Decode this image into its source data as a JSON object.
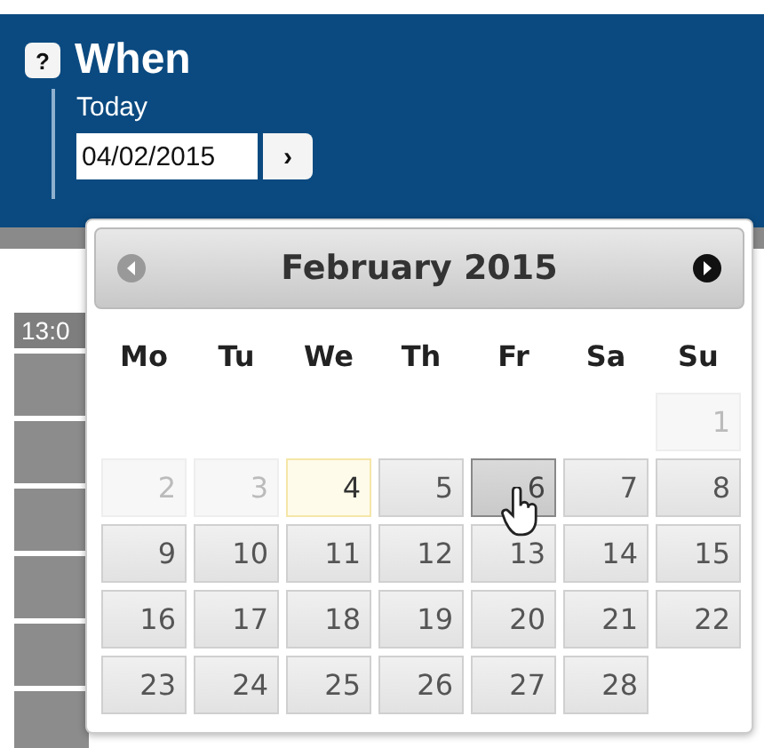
{
  "header": {
    "help_icon": "?",
    "title": "When",
    "subtitle": "Today",
    "date_value": "04/02/2015",
    "go_button": "›"
  },
  "background": {
    "time_label": "13:0"
  },
  "calendar": {
    "month": "February 2015",
    "prev_disabled": true,
    "next_disabled": false,
    "weekdays": [
      "Mo",
      "Tu",
      "We",
      "Th",
      "Fr",
      "Sa",
      "Su"
    ],
    "weeks": [
      {
        "days": [
          {
            "label": "1",
            "kind": "past"
          }
        ]
      },
      {
        "days": [
          {
            "label": "2",
            "kind": "past"
          },
          {
            "label": "3",
            "kind": "past"
          },
          {
            "label": "4",
            "kind": "today"
          },
          {
            "label": "5",
            "kind": "normal"
          },
          {
            "label": "6",
            "kind": "hover"
          },
          {
            "label": "7",
            "kind": "normal"
          },
          {
            "label": "8",
            "kind": "normal"
          }
        ]
      },
      {
        "days": [
          {
            "label": "9",
            "kind": "normal"
          },
          {
            "label": "10",
            "kind": "normal"
          },
          {
            "label": "11",
            "kind": "normal"
          },
          {
            "label": "12",
            "kind": "normal"
          },
          {
            "label": "13",
            "kind": "normal"
          },
          {
            "label": "14",
            "kind": "normal"
          },
          {
            "label": "15",
            "kind": "normal"
          }
        ]
      },
      {
        "days": [
          {
            "label": "16",
            "kind": "normal"
          },
          {
            "label": "17",
            "kind": "normal"
          },
          {
            "label": "18",
            "kind": "normal"
          },
          {
            "label": "19",
            "kind": "normal"
          },
          {
            "label": "20",
            "kind": "normal"
          },
          {
            "label": "21",
            "kind": "normal"
          },
          {
            "label": "22",
            "kind": "normal"
          }
        ]
      },
      {
        "days": [
          {
            "label": "23",
            "kind": "normal"
          },
          {
            "label": "24",
            "kind": "normal"
          },
          {
            "label": "25",
            "kind": "normal"
          },
          {
            "label": "26",
            "kind": "normal"
          },
          {
            "label": "27",
            "kind": "normal"
          },
          {
            "label": "28",
            "kind": "normal"
          }
        ]
      }
    ]
  }
}
